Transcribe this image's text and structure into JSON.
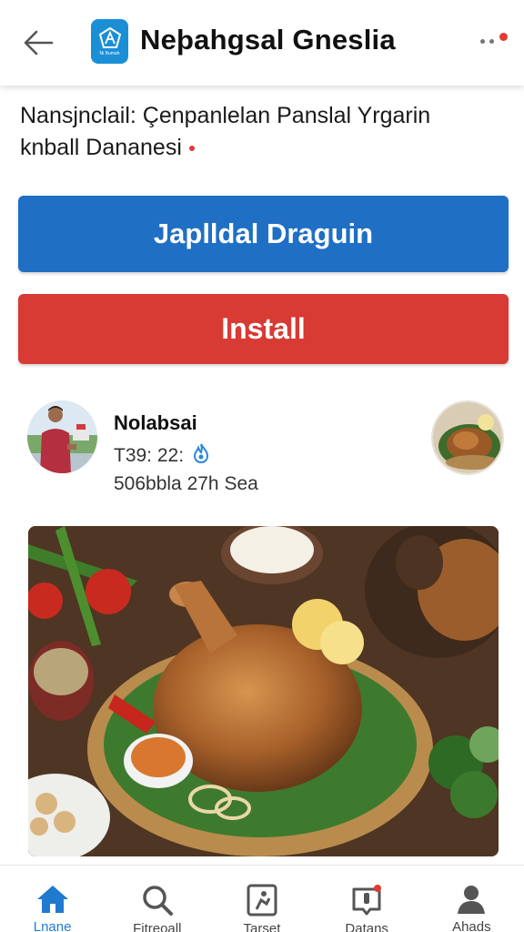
{
  "header": {
    "title": "Neþahgsal Gneslia",
    "logo_caption": "Ni Bumah",
    "back_icon": "arrow-left-icon",
    "more_icon": "more-dots-icon"
  },
  "intro": {
    "text_line1": "Nansjnclail: Çenpanlelan Panslal Yrgarin",
    "text_line2": "knball Dananesi"
  },
  "actions": {
    "primary_label": "Japlldal Draguin",
    "install_label": "Install"
  },
  "post": {
    "author_name": "Nolabsai",
    "meta": "T39: 22:",
    "meta_icon": "flame-icon",
    "subtext": "506bbla 27h Sea"
  },
  "bottom_nav": {
    "items": [
      {
        "label": "Lnane",
        "icon": "home-icon",
        "active": true
      },
      {
        "label": "Fitreoall",
        "icon": "search-icon",
        "active": false
      },
      {
        "label": "Tarset",
        "icon": "target-icon",
        "active": false
      },
      {
        "label": "Datans",
        "icon": "device-icon",
        "active": false,
        "badge": true
      },
      {
        "label": "Ahads",
        "icon": "profile-icon",
        "active": false
      }
    ]
  },
  "colors": {
    "primary": "#1f6fc4",
    "install": "#d83a34",
    "accent_active": "#1f7ad0",
    "notification": "#e03a33"
  }
}
